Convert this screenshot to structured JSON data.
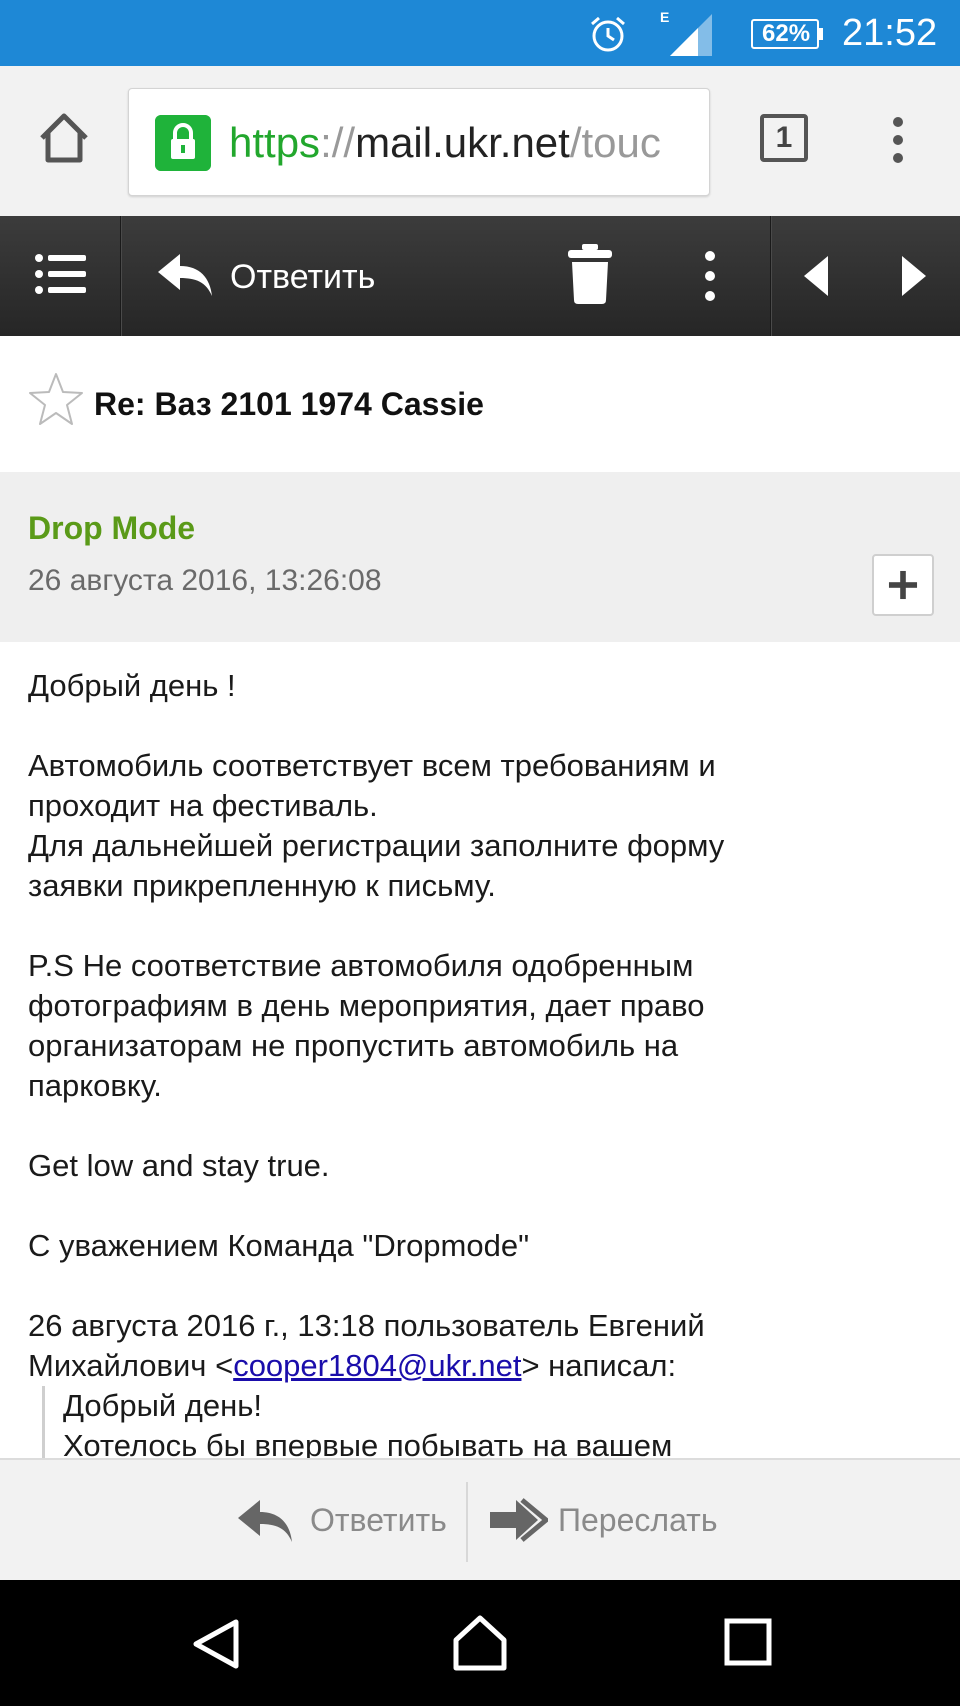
{
  "status_bar": {
    "network_type": "E",
    "battery": "62%",
    "time": "21:52"
  },
  "browser": {
    "url_scheme": "https",
    "url_sep": "://",
    "url_host": "mail.ukr.net",
    "url_path": "/touc",
    "tab_count": "1"
  },
  "toolbar": {
    "reply_label": "Ответить"
  },
  "message": {
    "subject": "Re: Ваз 2101 1974 Cassie",
    "sender": "Drop Mode",
    "date": "26 августа 2016, 13:26:08",
    "body": {
      "greeting": "Добрый день !",
      "p1_line1": "Автомобиль соответствует всем требованиям и",
      "p1_line2": "проходит на фестиваль.",
      "p1_line3": "Для дальнейшей регистрации заполните форму",
      "p1_line4": "заявки прикрепленную к письму.",
      "ps_line1": "P.S Не соответствие автомобиля одобренным",
      "ps_line2": "фотографиям в день мероприятия, дает право",
      "ps_line3": "организаторам не пропустить автомобиль на",
      "ps_line4": "парковку.",
      "motto": "Get low and stay true.",
      "signature": "С уважением Команда \"Dropmode\"",
      "quote_header_line1": "26 августа 2016 г., 13:18 пользователь Евгений",
      "quote_header_prefix": "Михайлович <",
      "quote_email": "cooper1804@ukr.net",
      "quote_header_suffix": "> написал:",
      "quote_line1": "Добрый день!",
      "quote_line2": "Хотелось бы впервые побывать на вашем"
    }
  },
  "bottom_actions": {
    "reply_label": "Ответить",
    "forward_label": "Переслать"
  }
}
